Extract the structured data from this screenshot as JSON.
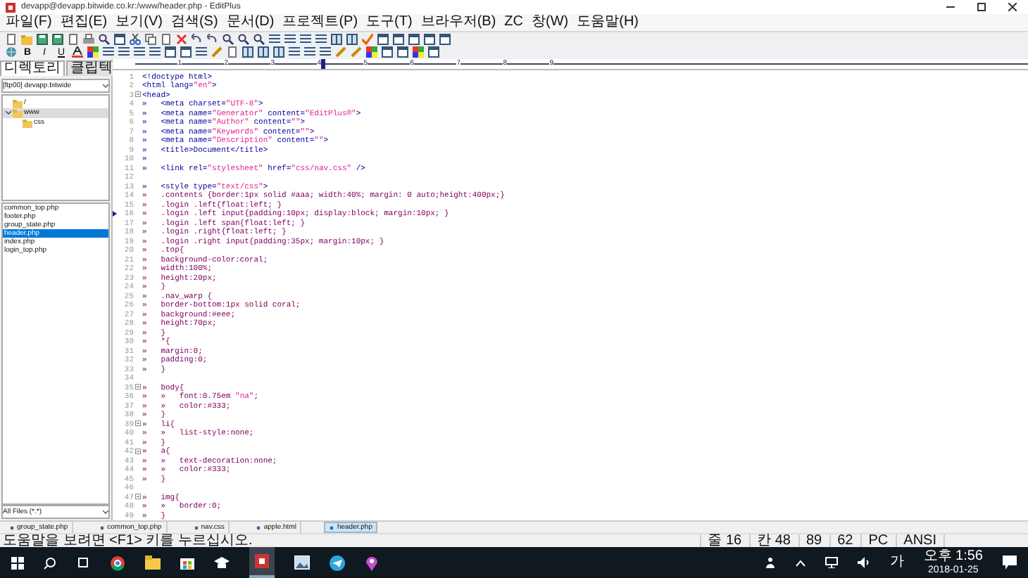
{
  "window": {
    "title": "devapp@devapp.bitwide.co.kr:/www/header.php - EditPlus"
  },
  "menu": [
    "파일(F)",
    "편집(E)",
    "보기(V)",
    "검색(S)",
    "문서(D)",
    "프로젝트(P)",
    "도구(T)",
    "브라우저(B)",
    "ZC",
    "창(W)",
    "도움말(H)"
  ],
  "format_buttons": [
    "B",
    "I",
    "U"
  ],
  "ruler": {
    "marks": [
      "1",
      "2",
      "3",
      "4",
      "5",
      "6",
      "7",
      "8",
      "9"
    ]
  },
  "sidebar": {
    "tabs": [
      {
        "label": "디렉토리",
        "selected": true
      },
      {
        "label": "클립텍",
        "selected": false
      }
    ],
    "drive": "[ftp00] devapp.bitwide",
    "tree": [
      {
        "label": "/",
        "expanded": false
      },
      {
        "label": "www",
        "expanded": true,
        "selected": true,
        "children": [
          {
            "label": "css",
            "expanded": false
          }
        ]
      }
    ],
    "files": [
      {
        "name": "common_top.php",
        "selected": false
      },
      {
        "name": "footer.php",
        "selected": false
      },
      {
        "name": "group_state.php",
        "selected": false
      },
      {
        "name": "header.php",
        "selected": true
      },
      {
        "name": "index.php",
        "selected": false
      },
      {
        "name": "login_top.php",
        "selected": false
      }
    ],
    "filter": "All Files (*.*)"
  },
  "editor": {
    "lines": [
      {
        "n": "1",
        "text": "<!doctype html>",
        "kind": "html"
      },
      {
        "n": "2",
        "text": "<html lang=\"en\">",
        "kind": "html"
      },
      {
        "n": "3",
        "text": "<head>",
        "kind": "html",
        "fold": true
      },
      {
        "n": "4",
        "text": "»   <meta charset=\"UTF-8\">",
        "kind": "html"
      },
      {
        "n": "5",
        "text": "»   <meta name=\"Generator\" content=\"EditPlus®\">",
        "kind": "html"
      },
      {
        "n": "6",
        "text": "»   <meta name=\"Author\" content=\"\">",
        "kind": "html"
      },
      {
        "n": "7",
        "text": "»   <meta name=\"Keywords\" content=\"\">",
        "kind": "html"
      },
      {
        "n": "8",
        "text": "»   <meta name=\"Description\" content=\"\">",
        "kind": "html"
      },
      {
        "n": "9",
        "text": "»   <title>Document</title>",
        "kind": "html"
      },
      {
        "n": "10",
        "text": "»",
        "kind": "html"
      },
      {
        "n": "11",
        "text": "»   <link rel=\"stylesheet\" href=\"css/nav.css\" />",
        "kind": "html"
      },
      {
        "n": "12"
      },
      {
        "n": "13",
        "text": "»   <style type=\"text/css\">",
        "kind": "html"
      },
      {
        "n": "14",
        "text": "»   .contents {border:1px solid #aaa; width:40%; margin: 0 auto;height:400px;}",
        "kind": "css"
      },
      {
        "n": "15",
        "text": "»   .login .left{float:left; }",
        "kind": "css"
      },
      {
        "n": "16",
        "text": "»   .login .left input{padding:10px; display:block; margin:10px; }",
        "kind": "css",
        "marked": true
      },
      {
        "n": "17",
        "text": "»   .login .left span{float:left; }",
        "kind": "css"
      },
      {
        "n": "18",
        "text": "»   .login .right{float:left; }",
        "kind": "css"
      },
      {
        "n": "19",
        "text": "»   .login .right input{padding:35px; margin:10px; }",
        "kind": "css"
      },
      {
        "n": "20",
        "text": "»   .top{",
        "kind": "css"
      },
      {
        "n": "21",
        "text": "»   background-color:coral;",
        "kind": "css"
      },
      {
        "n": "22",
        "text": "»   width:100%;",
        "kind": "css"
      },
      {
        "n": "23",
        "text": "»   height:20px;",
        "kind": "css"
      },
      {
        "n": "24",
        "text": "»   }",
        "kind": "css"
      },
      {
        "n": "25",
        "text": "»   .nav_warp {",
        "kind": "css"
      },
      {
        "n": "26",
        "text": "»   border-bottom:1px solid coral;",
        "kind": "css"
      },
      {
        "n": "27",
        "text": "»   background:#eee;",
        "kind": "css"
      },
      {
        "n": "28",
        "text": "»   height:70px;",
        "kind": "css"
      },
      {
        "n": "29",
        "text": "»   }",
        "kind": "css"
      },
      {
        "n": "30",
        "text": "»   *{",
        "kind": "css"
      },
      {
        "n": "31",
        "text": "»   margin:0;",
        "kind": "css"
      },
      {
        "n": "32",
        "text": "»   padding:0;",
        "kind": "css"
      },
      {
        "n": "33",
        "text": "»   }",
        "kind": "css"
      },
      {
        "n": "34"
      },
      {
        "n": "35",
        "text": "»   body{",
        "kind": "css",
        "fold": true
      },
      {
        "n": "36",
        "text": "»   »   font:0.75em \"na\";",
        "kind": "css"
      },
      {
        "n": "37",
        "text": "»   »   color:#333;",
        "kind": "css"
      },
      {
        "n": "38",
        "text": "»   }",
        "kind": "css"
      },
      {
        "n": "39",
        "text": "»   li{",
        "kind": "css",
        "fold": true
      },
      {
        "n": "40",
        "text": "»   »   list-style:none;",
        "kind": "css"
      },
      {
        "n": "41",
        "text": "»   }",
        "kind": "css"
      },
      {
        "n": "42",
        "text": "»   a{",
        "kind": "css",
        "fold": true
      },
      {
        "n": "43",
        "text": "»   »   text-decoration:none;",
        "kind": "css"
      },
      {
        "n": "44",
        "text": "»   »   color:#333;",
        "kind": "css"
      },
      {
        "n": "45",
        "text": "»   }",
        "kind": "css"
      },
      {
        "n": "46"
      },
      {
        "n": "47",
        "text": "»   img{",
        "kind": "css",
        "fold": true
      },
      {
        "n": "48",
        "text": "»   »   border:0;",
        "kind": "css"
      },
      {
        "n": "49",
        "text": "»   }",
        "kind": "css"
      }
    ]
  },
  "file_tabs": [
    {
      "label": "group_state.php",
      "selected": false
    },
    {
      "label": "common_top.php",
      "selected": false
    },
    {
      "label": "nav.css",
      "selected": false
    },
    {
      "label": "apple.html",
      "selected": false
    },
    {
      "label": "header.php",
      "selected": true
    }
  ],
  "status_bar": {
    "message": "도움말을 보려면 <F1> 키를 누르십시오.",
    "cells": [
      "줄 16",
      "칸 48",
      "89",
      "62",
      "PC",
      "ANSI"
    ]
  },
  "taskbar": {
    "time": "오후 1:56",
    "date": "2018-01-25",
    "ime": "가"
  }
}
